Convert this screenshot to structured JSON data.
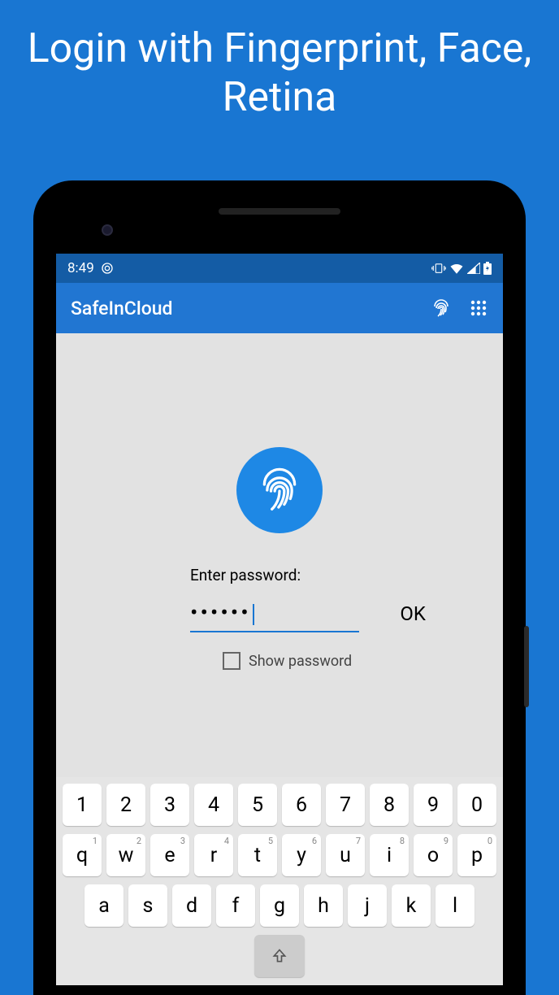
{
  "hero": {
    "title": "Login with Fingerprint, Face, Retina"
  },
  "statusBar": {
    "time": "8:49"
  },
  "appBar": {
    "title": "SafeInCloud"
  },
  "login": {
    "passwordLabel": "Enter password:",
    "passwordValue": "••••••",
    "okLabel": "OK",
    "showPasswordLabel": "Show password"
  },
  "keyboard": {
    "row1": [
      "1",
      "2",
      "3",
      "4",
      "5",
      "6",
      "7",
      "8",
      "9",
      "0"
    ],
    "row2": [
      "q",
      "w",
      "e",
      "r",
      "t",
      "y",
      "u",
      "i",
      "o",
      "p"
    ],
    "row3": [
      "a",
      "s",
      "d",
      "f",
      "g",
      "h",
      "j",
      "k",
      "l"
    ]
  }
}
